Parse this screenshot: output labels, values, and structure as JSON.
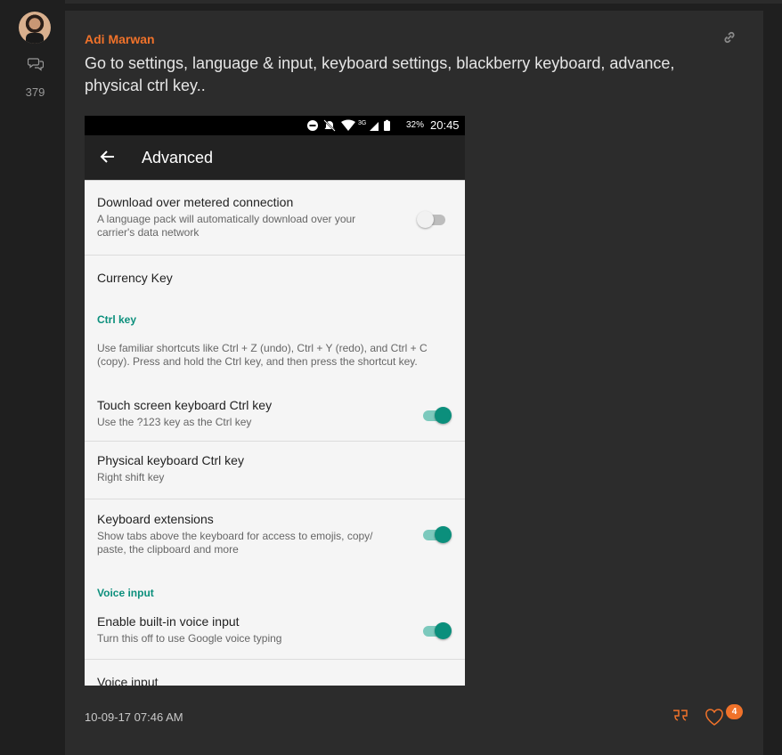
{
  "sidebar": {
    "post_count": "379",
    "avatar_icon": "user-avatar",
    "posts_icon": "chat-bubbles-icon"
  },
  "post": {
    "author": "Adi Marwan",
    "message": "Go to settings, language & input, keyboard settings, blackberry keyboard, advance, physical ctrl key..",
    "timestamp": "10-09-17 07:46 AM",
    "like_count": "4",
    "accent_color": "#f0722a"
  },
  "phone": {
    "status": {
      "network": "3G",
      "battery": "32%",
      "time": "20:45"
    },
    "appbar_title": "Advanced",
    "accent_color": "#0b8f7c",
    "items": [
      {
        "title": "Download over metered connection",
        "summary": "A language pack will automatically download over your carrier's data network",
        "toggle": "off"
      },
      {
        "title": "Currency Key",
        "summary": ""
      },
      {
        "section": "Ctrl key"
      },
      {
        "description": "Use familiar shortcuts like Ctrl + Z (undo), Ctrl + Y (redo), and Ctrl + C (copy). Press and hold the Ctrl key, and then press the shortcut key."
      },
      {
        "title": "Touch screen keyboard Ctrl key",
        "summary": "Use the ?123 key as the Ctrl key",
        "toggle": "on"
      },
      {
        "title": "Physical keyboard Ctrl key",
        "summary": "Right shift key"
      },
      {
        "title": "Keyboard extensions",
        "summary": "Show tabs above the keyboard for access to emojis, copy/ paste, the clipboard and more",
        "toggle": "on"
      },
      {
        "section": "Voice input"
      },
      {
        "title": "Enable built-in voice input",
        "summary": "Turn this off to use Google voice typing",
        "toggle": "on"
      },
      {
        "title": "Voice input"
      }
    ]
  }
}
